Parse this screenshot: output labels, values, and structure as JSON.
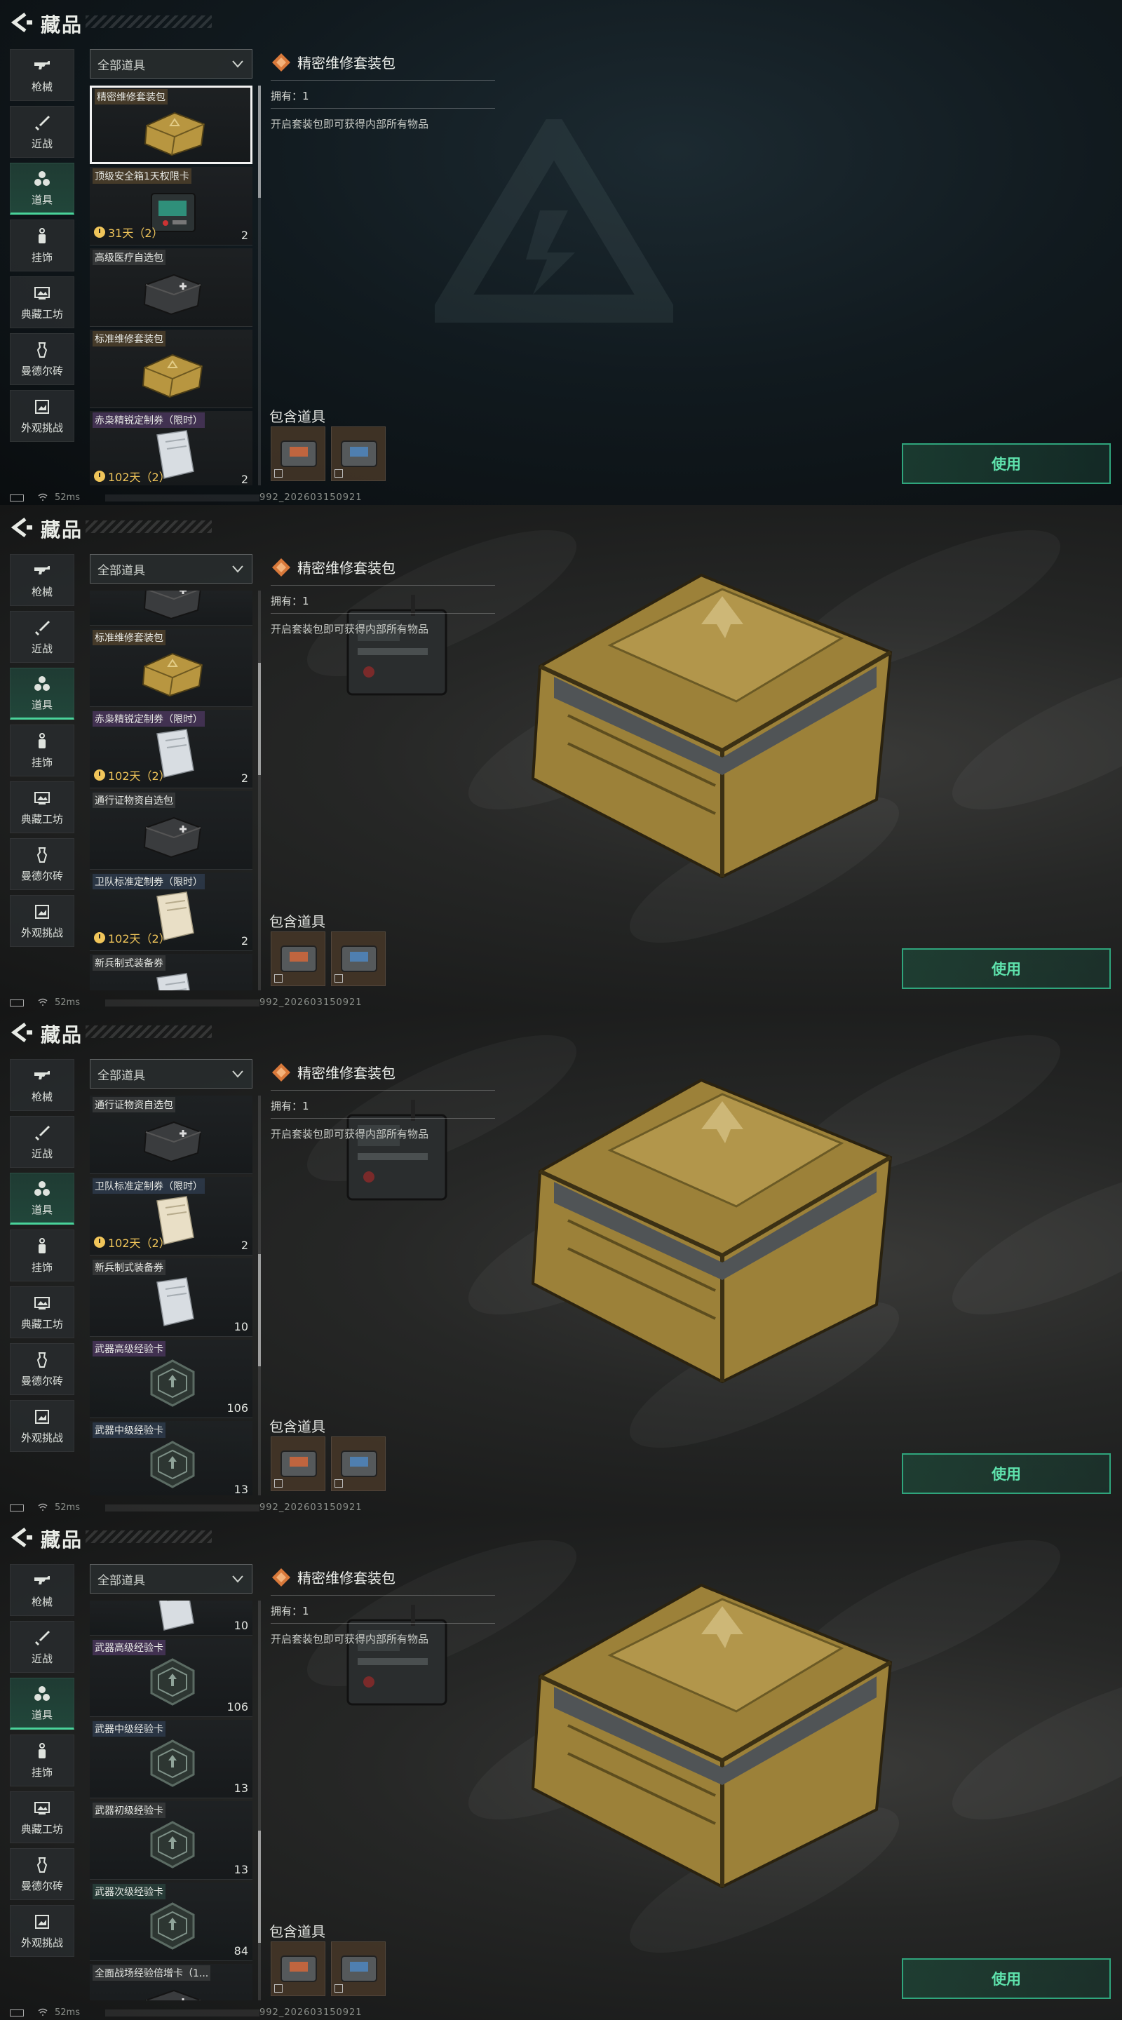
{
  "screens": [
    {
      "background": "dark",
      "header": {
        "title": "藏品"
      },
      "sidebar": [
        {
          "label": "枪械",
          "icon": "gun-icon",
          "active": false
        },
        {
          "label": "近战",
          "icon": "knife-icon",
          "active": false
        },
        {
          "label": "道具",
          "icon": "items-icon",
          "active": true
        },
        {
          "label": "挂饰",
          "icon": "charm-icon",
          "active": false
        },
        {
          "label": "典藏工坊",
          "icon": "workshop-icon",
          "active": false
        },
        {
          "label": "曼德尔砖",
          "icon": "brick-icon",
          "active": false
        },
        {
          "label": "外观挑战",
          "icon": "challenge-icon",
          "active": false
        }
      ],
      "filter": {
        "label": "全部道具"
      },
      "list_scroll": 0.0,
      "items": [
        {
          "name": "精密维修套装包",
          "tone": "gold",
          "pic": "gold-case",
          "selected": true,
          "timer": "",
          "count": ""
        },
        {
          "name": "顶级安全箱1天权限卡",
          "tone": "gold",
          "pic": "device",
          "selected": false,
          "timer": "31天（2）",
          "count": "2"
        },
        {
          "name": "高级医疗自选包",
          "tone": "gray",
          "pic": "med-case",
          "selected": false,
          "timer": "",
          "count": ""
        },
        {
          "name": "标准维修套装包",
          "tone": "gold",
          "pic": "gold-case",
          "selected": false,
          "timer": "",
          "count": ""
        },
        {
          "name": "赤枭精锐定制券（限时）",
          "tone": "purple",
          "pic": "voucher-white",
          "selected": false,
          "timer": "102天（2）",
          "count": "2"
        }
      ],
      "detail": {
        "title": "精密维修套装包",
        "owned": "拥有：1",
        "description": "开启套装包即可获得内部所有物品",
        "contains_title": "包含道具",
        "use_label": "使用"
      },
      "status": {
        "ping": "52ms",
        "uid": "992_202603150921"
      }
    },
    {
      "background": "cloth",
      "header": {
        "title": "藏品"
      },
      "sidebar": [
        {
          "label": "枪械",
          "icon": "gun-icon",
          "active": false
        },
        {
          "label": "近战",
          "icon": "knife-icon",
          "active": false
        },
        {
          "label": "道具",
          "icon": "items-icon",
          "active": true
        },
        {
          "label": "挂饰",
          "icon": "charm-icon",
          "active": false
        },
        {
          "label": "典藏工坊",
          "icon": "workshop-icon",
          "active": false
        },
        {
          "label": "曼德尔砖",
          "icon": "brick-icon",
          "active": false
        },
        {
          "label": "外观挑战",
          "icon": "challenge-icon",
          "active": false
        }
      ],
      "filter": {
        "label": "全部道具"
      },
      "list_scroll": 0.25,
      "items": [
        {
          "name": "",
          "tone": "none",
          "pic": "med-case",
          "selected": false,
          "timer": "",
          "count": "",
          "partial": true
        },
        {
          "name": "标准维修套装包",
          "tone": "gold",
          "pic": "gold-case",
          "selected": false,
          "timer": "",
          "count": ""
        },
        {
          "name": "赤枭精锐定制券（限时）",
          "tone": "purple",
          "pic": "voucher-white",
          "selected": false,
          "timer": "102天（2）",
          "count": "2"
        },
        {
          "name": "通行证物资自选包",
          "tone": "gray",
          "pic": "med-case",
          "selected": false,
          "timer": "",
          "count": ""
        },
        {
          "name": "卫队标准定制券（限时）",
          "tone": "blue",
          "pic": "voucher-cream",
          "selected": false,
          "timer": "102天（2）",
          "count": "2"
        },
        {
          "name": "新兵制式装备券",
          "tone": "gray",
          "pic": "voucher-white",
          "selected": false,
          "timer": "",
          "count": ""
        }
      ],
      "detail": {
        "title": "精密维修套装包",
        "owned": "拥有：1",
        "description": "开启套装包即可获得内部所有物品",
        "contains_title": "包含道具",
        "use_label": "使用"
      },
      "status": {
        "ping": "52ms",
        "uid": "992_202603150921"
      }
    },
    {
      "background": "cloth",
      "header": {
        "title": "藏品"
      },
      "sidebar": [
        {
          "label": "枪械",
          "icon": "gun-icon",
          "active": false
        },
        {
          "label": "近战",
          "icon": "knife-icon",
          "active": false
        },
        {
          "label": "道具",
          "icon": "items-icon",
          "active": true
        },
        {
          "label": "挂饰",
          "icon": "charm-icon",
          "active": false
        },
        {
          "label": "典藏工坊",
          "icon": "workshop-icon",
          "active": false
        },
        {
          "label": "曼德尔砖",
          "icon": "brick-icon",
          "active": false
        },
        {
          "label": "外观挑战",
          "icon": "challenge-icon",
          "active": false
        }
      ],
      "filter": {
        "label": "全部道具"
      },
      "list_scroll": 0.55,
      "items": [
        {
          "name": "通行证物资自选包",
          "tone": "gray",
          "pic": "med-case",
          "selected": false,
          "timer": "",
          "count": ""
        },
        {
          "name": "卫队标准定制券（限时）",
          "tone": "blue",
          "pic": "voucher-cream",
          "selected": false,
          "timer": "102天（2）",
          "count": "2"
        },
        {
          "name": "新兵制式装备券",
          "tone": "gray",
          "pic": "voucher-white",
          "selected": false,
          "timer": "",
          "count": "10"
        },
        {
          "name": "武器高级经验卡",
          "tone": "purple",
          "pic": "hex-card",
          "selected": false,
          "timer": "",
          "count": "106"
        },
        {
          "name": "武器中级经验卡",
          "tone": "blue",
          "pic": "hex-card",
          "selected": false,
          "timer": "",
          "count": "13"
        }
      ],
      "detail": {
        "title": "精密维修套装包",
        "owned": "拥有：1",
        "description": "开启套装包即可获得内部所有物品",
        "contains_title": "包含道具",
        "use_label": "使用"
      },
      "status": {
        "ping": "52ms",
        "uid": "992_202603150921"
      }
    },
    {
      "background": "cloth",
      "header": {
        "title": "藏品"
      },
      "sidebar": [
        {
          "label": "枪械",
          "icon": "gun-icon",
          "active": false
        },
        {
          "label": "近战",
          "icon": "knife-icon",
          "active": false
        },
        {
          "label": "道具",
          "icon": "items-icon",
          "active": true
        },
        {
          "label": "挂饰",
          "icon": "charm-icon",
          "active": false
        },
        {
          "label": "典藏工坊",
          "icon": "workshop-icon",
          "active": false
        },
        {
          "label": "曼德尔砖",
          "icon": "brick-icon",
          "active": false
        },
        {
          "label": "外观挑战",
          "icon": "challenge-icon",
          "active": false
        }
      ],
      "filter": {
        "label": "全部道具"
      },
      "list_scroll": 0.8,
      "items": [
        {
          "name": "",
          "tone": "none",
          "pic": "voucher-white",
          "selected": false,
          "timer": "",
          "count": "10",
          "partial": true
        },
        {
          "name": "武器高级经验卡",
          "tone": "purple",
          "pic": "hex-card",
          "selected": false,
          "timer": "",
          "count": "106"
        },
        {
          "name": "武器中级经验卡",
          "tone": "blue",
          "pic": "hex-card",
          "selected": false,
          "timer": "",
          "count": "13"
        },
        {
          "name": "武器初级经验卡",
          "tone": "gray",
          "pic": "hex-card",
          "selected": false,
          "timer": "",
          "count": "13"
        },
        {
          "name": "武器次级经验卡",
          "tone": "green",
          "pic": "hex-card",
          "selected": false,
          "timer": "",
          "count": "84"
        },
        {
          "name": "全面战场经验倍增卡（1...",
          "tone": "gray",
          "pic": "med-case",
          "selected": false,
          "timer": "",
          "count": ""
        }
      ],
      "detail": {
        "title": "精密维修套装包",
        "owned": "拥有：1",
        "description": "开启套装包即可获得内部所有物品",
        "contains_title": "包含道具",
        "use_label": "使用"
      },
      "status": {
        "ping": "52ms",
        "uid": "992_202603150921"
      }
    }
  ],
  "colors": {
    "accent": "#49d39a",
    "use_text": "#5fe3ad",
    "timer": "#f0c55a",
    "case_gold": "#b89640"
  }
}
